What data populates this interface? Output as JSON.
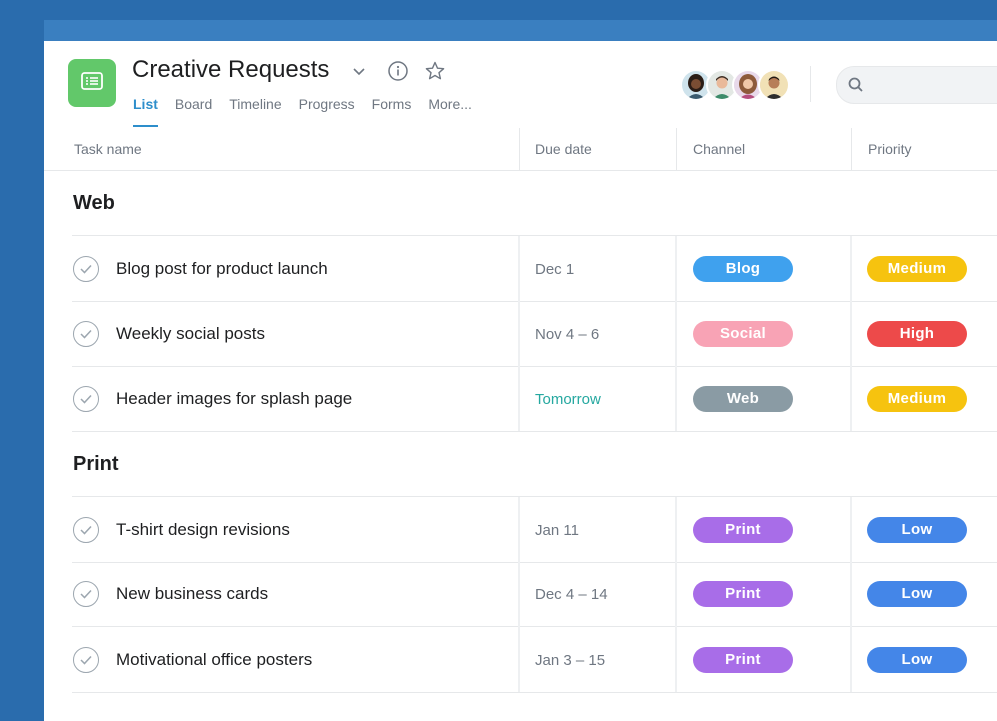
{
  "project": {
    "title": "Creative Requests",
    "icon": "list-icon",
    "icon_color": "#62c86a"
  },
  "tabs": [
    {
      "label": "List",
      "active": true
    },
    {
      "label": "Board"
    },
    {
      "label": "Timeline"
    },
    {
      "label": "Progress"
    },
    {
      "label": "Forms"
    },
    {
      "label": "More..."
    }
  ],
  "columns": {
    "task_name": "Task name",
    "due_date": "Due date",
    "channel": "Channel",
    "priority": "Priority"
  },
  "sections": [
    {
      "title": "Web",
      "tasks": [
        {
          "name": "Blog post for product launch",
          "due": "Dec 1",
          "channel": "Blog",
          "channel_color": "#3fa1ee",
          "priority": "Medium",
          "priority_color": "#f6c30f"
        },
        {
          "name": "Weekly social posts",
          "due": "Nov 4 – 6",
          "channel": "Social",
          "channel_color": "#f8a3b5",
          "priority": "High",
          "priority_color": "#ed4a4a"
        },
        {
          "name": "Header images for splash page",
          "due": "Tomorrow",
          "due_color": "#25a8a0",
          "channel": "Web",
          "channel_color": "#8a9ba4",
          "priority": "Medium",
          "priority_color": "#f6c30f"
        }
      ]
    },
    {
      "title": "Print",
      "tasks": [
        {
          "name": "T-shirt design revisions",
          "due": "Jan 11",
          "channel": "Print",
          "channel_color": "#a86de8",
          "priority": "Low",
          "priority_color": "#4486e8"
        },
        {
          "name": "New business cards",
          "due": "Dec 4 – 14",
          "channel": "Print",
          "channel_color": "#a86de8",
          "priority": "Low",
          "priority_color": "#4486e8"
        },
        {
          "name": "Motivational office posters",
          "due": "Jan 3 – 15",
          "channel": "Print",
          "channel_color": "#a86de8",
          "priority": "Low",
          "priority_color": "#4486e8"
        }
      ]
    }
  ],
  "colors": {
    "background": "#2a6cad",
    "accent": "#2d8ecb"
  }
}
